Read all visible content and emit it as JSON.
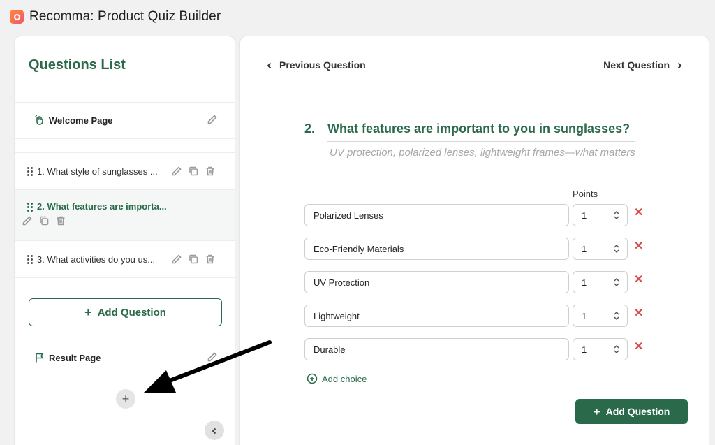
{
  "app": {
    "title": "Recomma: Product Quiz Builder"
  },
  "sidebar": {
    "title": "Questions List",
    "welcome_label": "Welcome Page",
    "questions": [
      {
        "label": "1. What style of sunglasses ..."
      },
      {
        "label": "2. What features are importa..."
      },
      {
        "label": "3. What activities do you us..."
      }
    ],
    "add_question_label": "Add Question",
    "result_label": "Result Page"
  },
  "main": {
    "prev_label": "Previous Question",
    "next_label": "Next Question",
    "question_number": "2.",
    "question_text": "What features are important to you in sunglasses?",
    "question_subtitle": "UV protection, polarized lenses, lightweight frames—what matters most?",
    "points_label": "Points",
    "choices": [
      {
        "label": "Polarized Lenses",
        "points": "1"
      },
      {
        "label": "Eco-Friendly Materials",
        "points": "1"
      },
      {
        "label": "UV Protection",
        "points": "1"
      },
      {
        "label": "Lightweight",
        "points": "1"
      },
      {
        "label": "Durable",
        "points": "1"
      }
    ],
    "add_choice_label": "Add choice",
    "add_question_label": "Add Question"
  },
  "colors": {
    "accent": "#2a6a4a",
    "remove": "#d94a4a",
    "logo_start": "#ff8a3d",
    "logo_end": "#f2556b"
  }
}
